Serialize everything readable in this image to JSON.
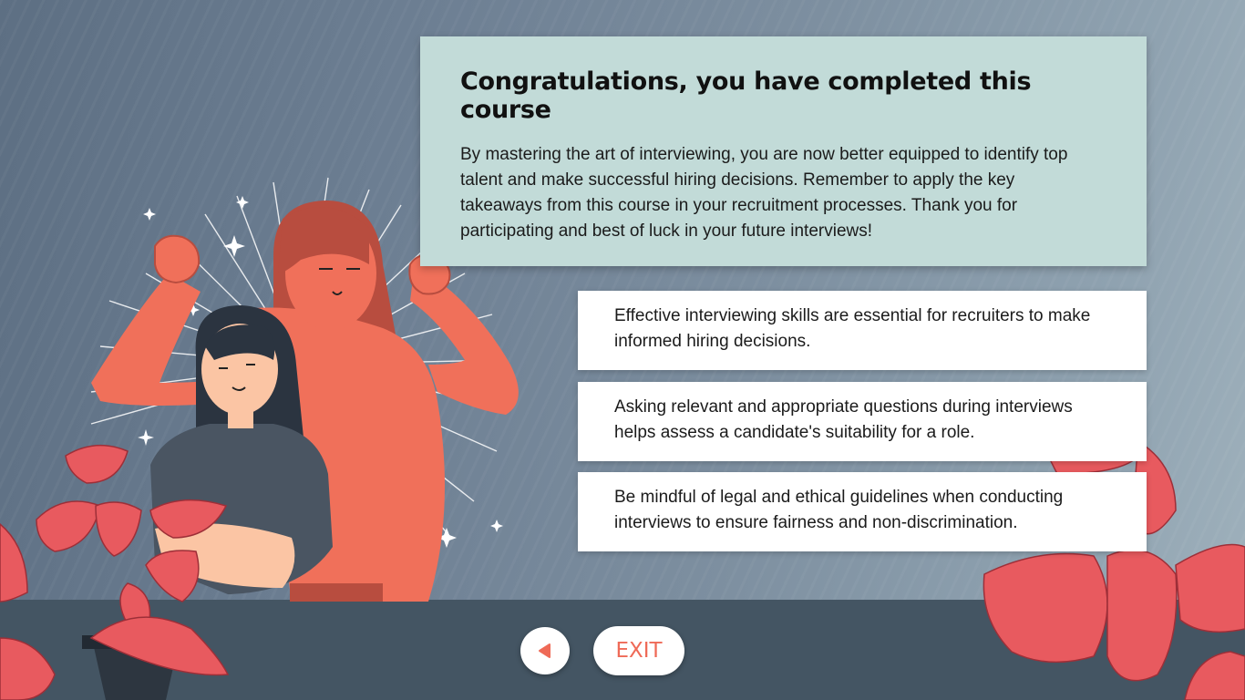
{
  "summary": {
    "title": "Congratulations, you have completed this course",
    "body": "By mastering the art of interviewing, you are now better equipped to identify top talent and make successful hiring decisions. Remember to apply the key takeaways from this course in your recruitment processes. Thank you for participating and best of luck in your future interviews!"
  },
  "takeaways": [
    "Effective interviewing skills are essential for recruiters to make informed hiring decisions.",
    "Asking relevant and appropriate questions during interviews helps assess a candidate's suitability for a role.",
    "Be mindful of legal and ethical guidelines when conducting interviews to ensure fairness and non-discrimination."
  ],
  "nav": {
    "back_icon": "triangle-left-icon",
    "exit_label": "EXIT"
  },
  "colors": {
    "accent": "#ef6a57",
    "summary_bg": "#c2dbd8",
    "bottom_bar": "#445563",
    "leaf": "#e85a5f"
  }
}
